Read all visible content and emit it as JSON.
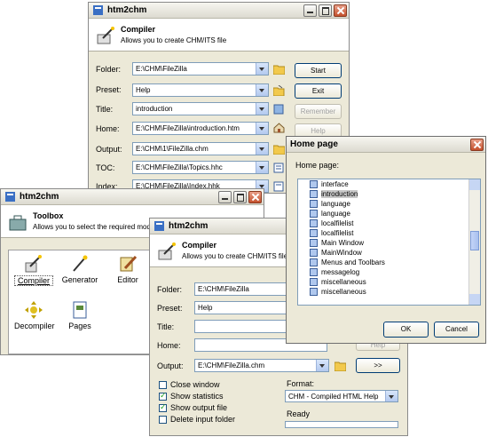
{
  "win1": {
    "title": "htm2chm",
    "header_title": "Compiler",
    "header_sub": "Allows you to create CHM/ITS file",
    "labels": {
      "folder": "Folder:",
      "preset": "Preset:",
      "title": "Title:",
      "home": "Home:",
      "output": "Output:",
      "toc": "TOC:",
      "index": "Index:"
    },
    "values": {
      "folder": "E:\\CHM\\FileZilla",
      "preset": "Help",
      "title": "introduction",
      "home": "E:\\CHM\\FileZilla\\introduction.htm",
      "output": "E:\\CHM\\1\\FileZilla.chm",
      "toc": "E:\\CHM\\FileZilla\\Topics.hhc",
      "index": "E:\\CHM\\FileZilla\\Index.hhk"
    },
    "buttons": {
      "start": "Start",
      "exit": "Exit",
      "remember": "Remember",
      "help": "Help"
    }
  },
  "win2": {
    "title": "htm2chm",
    "header_title": "Toolbox",
    "header_sub": "Allows you to select the required mode",
    "tools": [
      "Compiler",
      "Generator",
      "Editor",
      "Decompiler",
      "Pages"
    ]
  },
  "win3": {
    "title": "htm2chm",
    "header_title": "Compiler",
    "header_sub": "Allows you to create CHM/ITS file",
    "labels": {
      "folder": "Folder:",
      "preset": "Preset:",
      "title": "Title:",
      "home": "Home:",
      "output": "Output:"
    },
    "values": {
      "folder": "E:\\CHM\\FileZilla",
      "preset": "Help",
      "title": "",
      "home": "",
      "output": "E:\\CHM\\FileZilla.chm"
    },
    "more_button": ">>",
    "help_button": "Help",
    "checkboxes": [
      {
        "label": "Close window",
        "checked": false
      },
      {
        "label": "Show statistics",
        "checked": true
      },
      {
        "label": "Show output file",
        "checked": true
      },
      {
        "label": "Delete input folder",
        "checked": false
      }
    ],
    "format_label": "Format:",
    "format_value": "CHM - Compiled HTML Help",
    "status": "Ready"
  },
  "win4": {
    "title": "Home page",
    "label": "Home page:",
    "items": [
      "interface",
      "introduction",
      "language",
      "language",
      "localfilelist",
      "localfilelist",
      "Main Window",
      "MainWindow",
      "Menus and Toolbars",
      "messagelog",
      "miscellaneous",
      "miscellaneous"
    ],
    "selected_index": 1,
    "ok": "OK",
    "cancel": "Cancel"
  }
}
